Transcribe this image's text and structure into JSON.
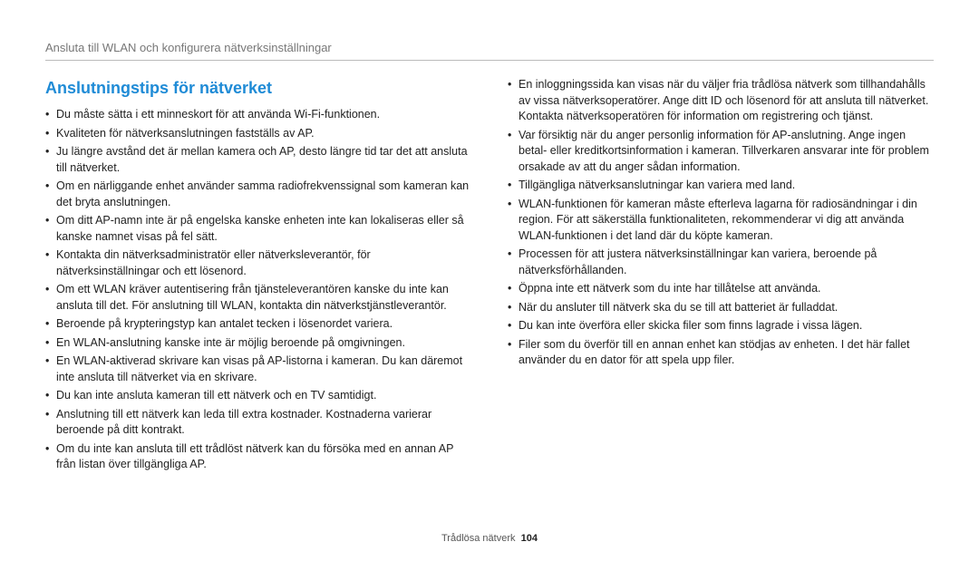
{
  "header": {
    "breadcrumb": "Ansluta till WLAN och konfigurera nätverksinställningar"
  },
  "section_title": "Anslutningstips för nätverket",
  "left_items": [
    "Du måste sätta i ett minneskort för att använda Wi-Fi-funktionen.",
    "Kvaliteten för nätverksanslutningen fastställs av AP.",
    "Ju längre avstånd det är mellan kamera och AP, desto längre tid tar det att ansluta till nätverket.",
    "Om en närliggande enhet använder samma radiofrekvenssignal som kameran kan det bryta anslutningen.",
    "Om ditt AP-namn inte är på engelska kanske enheten inte kan lokaliseras eller så kanske namnet visas på fel sätt.",
    "Kontakta din nätverksadministratör eller nätverksleverantör, för nätverksinställningar och ett lösenord.",
    "Om ett WLAN kräver autentisering från tjänsteleverantören kanske du inte kan ansluta till det. För anslutning till WLAN, kontakta din nätverkstjänstleverantör.",
    "Beroende på krypteringstyp kan antalet tecken i lösenordet variera.",
    "En WLAN-anslutning kanske inte är möjlig beroende på omgivningen.",
    "En WLAN-aktiverad skrivare kan visas på AP-listorna i kameran. Du kan däremot inte ansluta till nätverket via en skrivare.",
    "Du kan inte ansluta kameran till ett nätverk och en TV samtidigt.",
    "Anslutning till ett nätverk kan leda till extra kostnader. Kostnaderna varierar beroende på ditt kontrakt.",
    "Om du inte kan ansluta till ett trådlöst nätverk kan du försöka med en annan AP från listan över tillgängliga AP."
  ],
  "right_items": [
    "En inloggningssida kan visas när du väljer fria trådlösa nätverk som tillhandahålls av vissa nätverksoperatörer. Ange ditt ID och lösenord för att ansluta till nätverket. Kontakta nätverksoperatören för information om registrering och tjänst.",
    "Var försiktig när du anger personlig information för AP-anslutning. Ange ingen betal- eller kreditkortsinformation i kameran. Tillverkaren ansvarar inte för problem orsakade av att du anger sådan information.",
    "Tillgängliga nätverksanslutningar kan variera med land.",
    "WLAN-funktionen för kameran måste efterleva lagarna för radiosändningar i din region. För att säkerställa funktionaliteten, rekommenderar vi dig att använda WLAN-funktionen i det land där du köpte kameran.",
    "Processen för att justera nätverksinställningar kan variera, beroende på nätverksförhållanden.",
    "Öppna inte ett nätverk som du inte har tillåtelse att använda.",
    "När du ansluter till nätverk ska du se till att batteriet är fulladdat.",
    "Du kan inte överföra eller skicka filer som finns lagrade i vissa lägen.",
    "Filer som du överför till en annan enhet kan stödjas av enheten. I det här fallet använder du en dator för att spela upp filer."
  ],
  "footer": {
    "label": "Trådlösa nätverk",
    "page": "104"
  }
}
